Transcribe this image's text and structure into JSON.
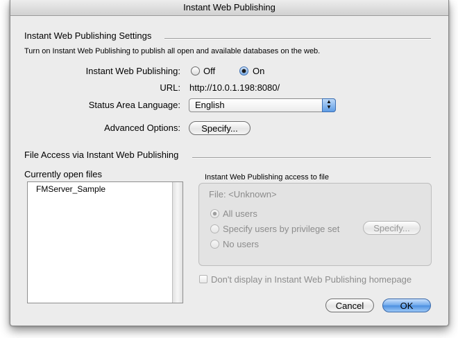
{
  "window": {
    "title": "Instant Web Publishing"
  },
  "settings": {
    "group_title": "Instant Web Publishing Settings",
    "description": "Turn on Instant Web Publishing to publish all open and available databases on the web.",
    "iwp_label": "Instant Web Publishing:",
    "off_label": "Off",
    "on_label": "On",
    "selected": "On",
    "url_label": "URL:",
    "url_value": "http://10.0.1.198:8080/",
    "status_lang_label": "Status Area Language:",
    "status_lang_value": "English",
    "advanced_label": "Advanced Options:",
    "specify_label": "Specify..."
  },
  "file_access": {
    "group_title": "File Access via Instant Web Publishing",
    "open_files_label": "Currently open files",
    "files": [
      "FMServer_Sample"
    ],
    "access_title": "Instant Web Publishing access to file",
    "file_label": "File: <Unknown>",
    "all_users": "All users",
    "by_privilege": "Specify users by privilege set",
    "no_users": "No users",
    "specify_label": "Specify...",
    "dont_display": "Don't display in Instant Web Publishing homepage"
  },
  "buttons": {
    "cancel": "Cancel",
    "ok": "OK"
  },
  "colors": {
    "accent": "#5f9de6",
    "window_bg": "#ececec"
  }
}
